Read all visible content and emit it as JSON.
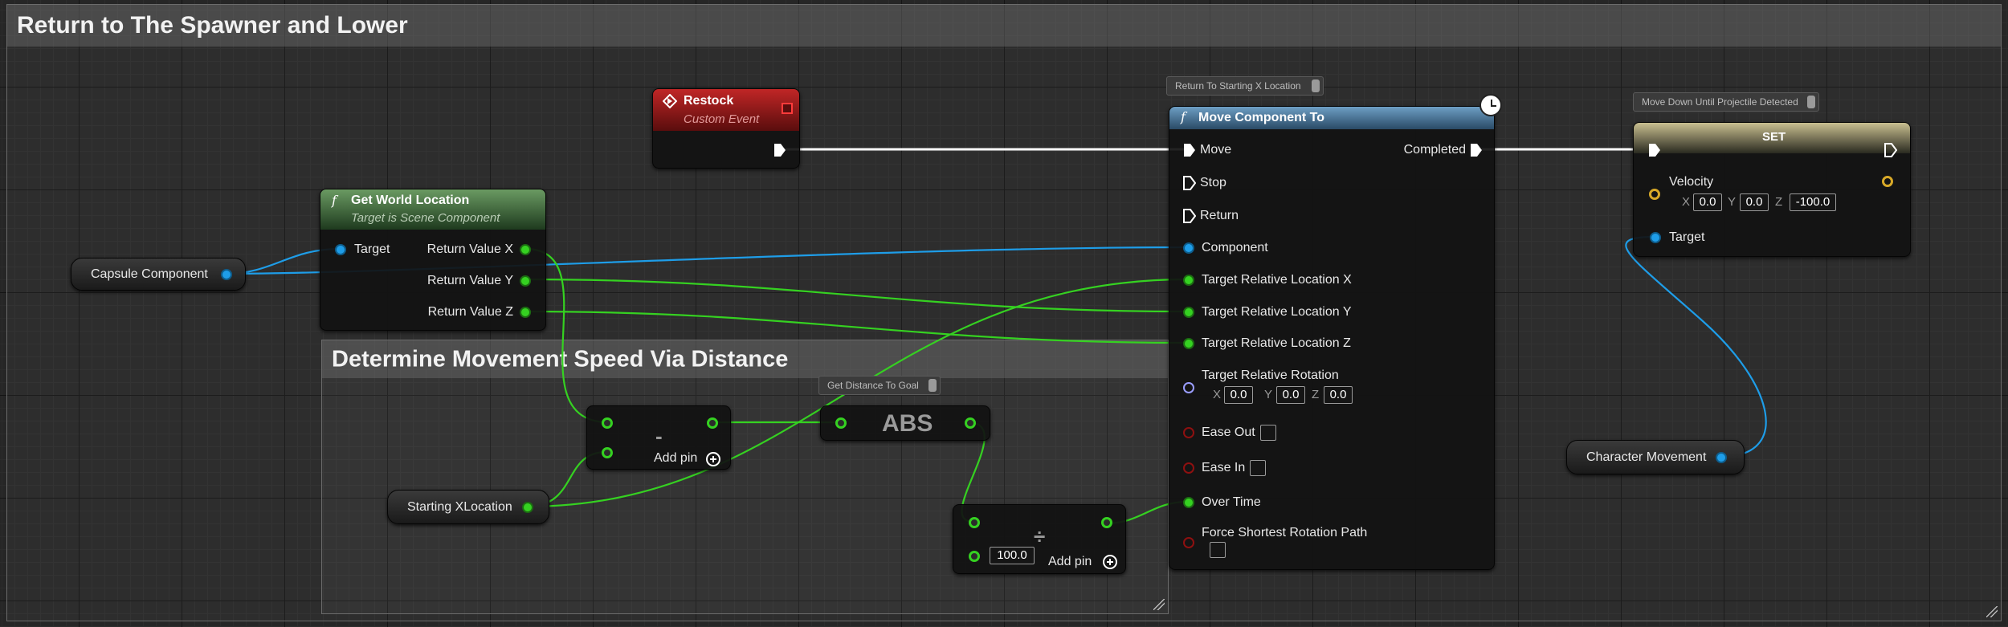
{
  "comments": {
    "outer_title": "Return to The Spawner and Lower",
    "inner_title": "Determine Movement Speed Via Distance"
  },
  "nodes": {
    "restock": {
      "title": "Restock",
      "subtitle": "Custom Event"
    },
    "get_world_location": {
      "title": "Get World Location",
      "subtitle": "Target is Scene Component",
      "target": "Target",
      "return_x": "Return Value X",
      "return_y": "Return Value Y",
      "return_z": "Return Value Z"
    },
    "capsule": {
      "label": "Capsule Component"
    },
    "starting_x": {
      "label": "Starting XLocation"
    },
    "subtract": {
      "symbol": "-",
      "add_pin": "Add pin"
    },
    "abs": {
      "label": "ABS",
      "comment": "Get Distance To Goal"
    },
    "divide": {
      "symbol": "÷",
      "value": "100.0",
      "add_pin": "Add pin"
    },
    "move_component": {
      "comment": "Return To Starting X Location",
      "title": "Move Component To",
      "move": "Move",
      "stop": "Stop",
      "return": "Return",
      "completed": "Completed",
      "component": "Component",
      "target_x": "Target Relative Location X",
      "target_y": "Target Relative Location Y",
      "target_z": "Target Relative Location Z",
      "target_rotation": "Target Relative Rotation",
      "rot_x_label": "X",
      "rot_x": "0.0",
      "rot_y_label": "Y",
      "rot_y": "0.0",
      "rot_z_label": "Z",
      "rot_z": "0.0",
      "ease_out": "Ease Out",
      "ease_in": "Ease In",
      "over_time": "Over Time",
      "force_shortest": "Force Shortest Rotation Path"
    },
    "set": {
      "comment": "Move Down Until Projectile Detected",
      "title": "SET",
      "velocity": "Velocity",
      "vx_label": "X",
      "vx": "0.0",
      "vy_label": "Y",
      "vy": "0.0",
      "vz_label": "Z",
      "vz": "-100.0",
      "target": "Target"
    },
    "character_movement": {
      "label": "Character Movement"
    }
  },
  "colors": {
    "float_pin": "#35d121",
    "object_pin": "#1e9de8",
    "vector_pin": "#d8a928",
    "bool_pin": "#8e1010",
    "rotator_pin": "#9a9dff",
    "event_header": "#9b1b1b",
    "function_header": "#4e7ca0",
    "pure_function_header": "#5a8a52",
    "set_header": "#c2b68a"
  }
}
